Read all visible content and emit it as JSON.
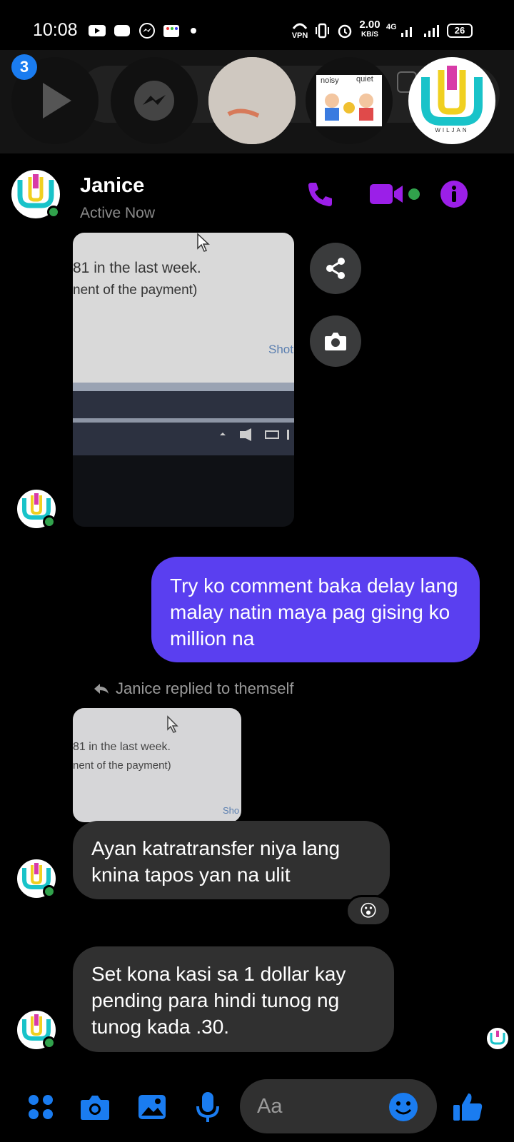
{
  "status_bar": {
    "time": "10:08",
    "vpn": "VPN",
    "speed_value": "2.00",
    "speed_unit": "KB/S",
    "network": "4G",
    "battery": "26"
  },
  "chat_heads": {
    "badge_count": "3",
    "items": [
      "video-icon",
      "messenger-icon",
      "photo-thumb",
      "noisy-quiet-thumb",
      "wiljan-logo"
    ],
    "noisy_label": "noisy",
    "quiet_label": "quiet",
    "logo_caption": "WILJAN"
  },
  "header": {
    "name": "Janice",
    "status": "Active Now"
  },
  "messages": {
    "photo1_line1": "81 in the last week.",
    "photo1_line2": "nent of the payment)",
    "photo1_corner": "Shot",
    "outgoing_text": "Try ko comment baka delay lang malay natin maya pag gising ko million na",
    "reply_note": "Janice replied to themself",
    "photo2_line1": "81 in the last week.",
    "photo2_line2": "nent of the payment)",
    "photo2_corner": "Sho",
    "incoming1": "Ayan katratransfer niya lang knina tapos yan na ulit",
    "reaction": "😮",
    "incoming2": "Set kona kasi sa 1 dollar kay pending para hindi tunog ng tunog kada .30."
  },
  "composer": {
    "placeholder": "Aa"
  },
  "colors": {
    "accent_purple": "#9b1fe8",
    "outgoing_bubble": "#5a3ff0",
    "incoming_bubble": "#303030",
    "composer_blue": "#1a7cf0",
    "online_green": "#31a24c"
  }
}
